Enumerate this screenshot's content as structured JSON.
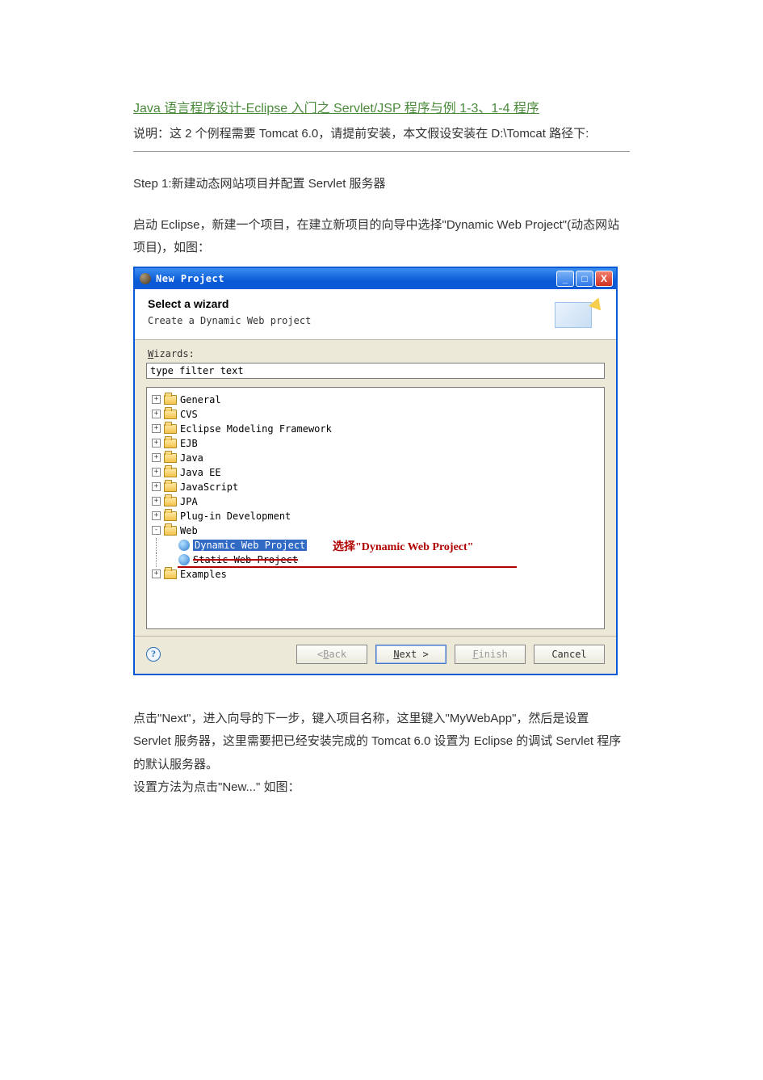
{
  "doc": {
    "title_link": "Java 语言程序设计-Eclipse 入门之 Servlet/JSP 程序与例 1-3、1-4 程序",
    "intro": "说明：这 2 个例程需要 Tomcat 6.0，请提前安装，本文假设安装在 D:\\Tomcat 路径下:",
    "step1_title": "Step 1:新建动态网站项目并配置 Servlet 服务器",
    "step1_body": "启动 Eclipse，新建一个项目，在建立新项目的向导中选择\"Dynamic Web Project\"(动态网站项目)，如图：",
    "after1": "点击\"Next\"，进入向导的下一步，键入项目名称，这里键入\"MyWebApp\"，然后是设置 Servlet 服务器，这里需要把已经安装完成的 Tomcat 6.0 设置为 Eclipse 的调试 Servlet 程序的默认服务器。",
    "after2": "设置方法为点击\"New...\"  如图："
  },
  "dialog": {
    "title": "New Project",
    "header_title": "Select a wizard",
    "header_sub": "Create a Dynamic Web project",
    "wizards_label_pre": "W",
    "wizards_label_rest": "izards:",
    "filter_value": "type filter text",
    "tree": [
      {
        "expand": "+",
        "icon": "folder",
        "label": "General",
        "depth": 0
      },
      {
        "expand": "+",
        "icon": "folder",
        "label": "CVS",
        "depth": 0
      },
      {
        "expand": "+",
        "icon": "folder",
        "label": "Eclipse Modeling Framework",
        "depth": 0
      },
      {
        "expand": "+",
        "icon": "folder",
        "label": "EJB",
        "depth": 0
      },
      {
        "expand": "+",
        "icon": "folder",
        "label": "Java",
        "depth": 0
      },
      {
        "expand": "+",
        "icon": "folder",
        "label": "Java EE",
        "depth": 0
      },
      {
        "expand": "+",
        "icon": "folder",
        "label": "JavaScript",
        "depth": 0
      },
      {
        "expand": "+",
        "icon": "folder",
        "label": "JPA",
        "depth": 0
      },
      {
        "expand": "+",
        "icon": "folder",
        "label": "Plug-in Development",
        "depth": 0
      },
      {
        "expand": "-",
        "icon": "folder",
        "label": "Web",
        "depth": 0
      },
      {
        "expand": "",
        "icon": "proj",
        "label": "Dynamic Web Project",
        "depth": 1,
        "selected": true
      },
      {
        "expand": "",
        "icon": "proj",
        "label": "Static Web Project",
        "depth": 1,
        "strike": true
      },
      {
        "expand": "+",
        "icon": "folder",
        "label": "Examples",
        "depth": 0
      }
    ],
    "callout": "选择\"Dynamic Web Project\"",
    "buttons": {
      "back": "< Back",
      "next": "Next >",
      "finish": "Finish",
      "cancel": "Cancel"
    },
    "help_glyph": "?"
  }
}
